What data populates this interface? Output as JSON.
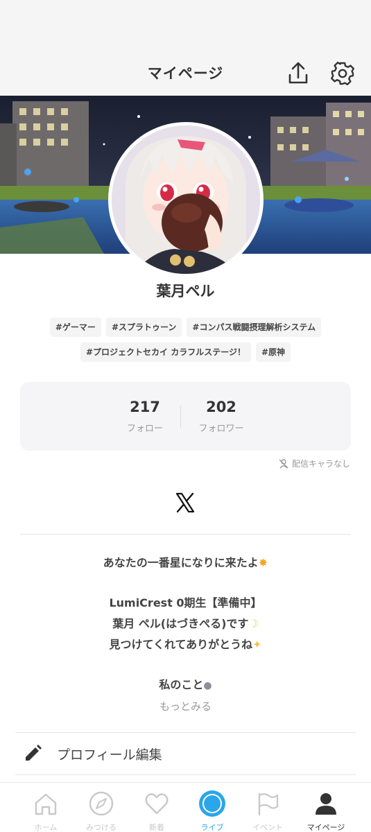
{
  "header": {
    "title": "マイページ"
  },
  "profile": {
    "name": "葉月ペル",
    "tags": [
      "#ゲーマー",
      "#スプラトゥーン",
      "#コンパス戦闘摂理解析システム",
      "#プロジェクトセカイ カラフルステージ！",
      "#原神"
    ]
  },
  "stats": {
    "follow_count": "217",
    "follow_label": "フォロー",
    "follower_count": "202",
    "follower_label": "フォロワー"
  },
  "no_character_label": "配信キャラなし",
  "bio": {
    "line1": "あなたの一番星になりに来たよ",
    "line2": "LumiCrest 0期生【準備中】",
    "line3": "葉月 ペル(はづきぺる)です",
    "line4": "見つけてくれてありがとうね",
    "line5": "私のこと",
    "more_label": "もっとみる"
  },
  "edit_profile_label": "プロフィール編集",
  "tabs": [
    {
      "label": "ホーム",
      "icon": "home-icon"
    },
    {
      "label": "みつける",
      "icon": "compass-icon"
    },
    {
      "label": "新着",
      "icon": "heart-icon"
    },
    {
      "label": "ライブ",
      "icon": "live-icon"
    },
    {
      "label": "イベント",
      "icon": "flag-icon"
    },
    {
      "label": "マイページ",
      "icon": "person-icon"
    }
  ],
  "colors": {
    "accent": "#2aa6ea",
    "text": "#333333",
    "muted": "#999999"
  }
}
